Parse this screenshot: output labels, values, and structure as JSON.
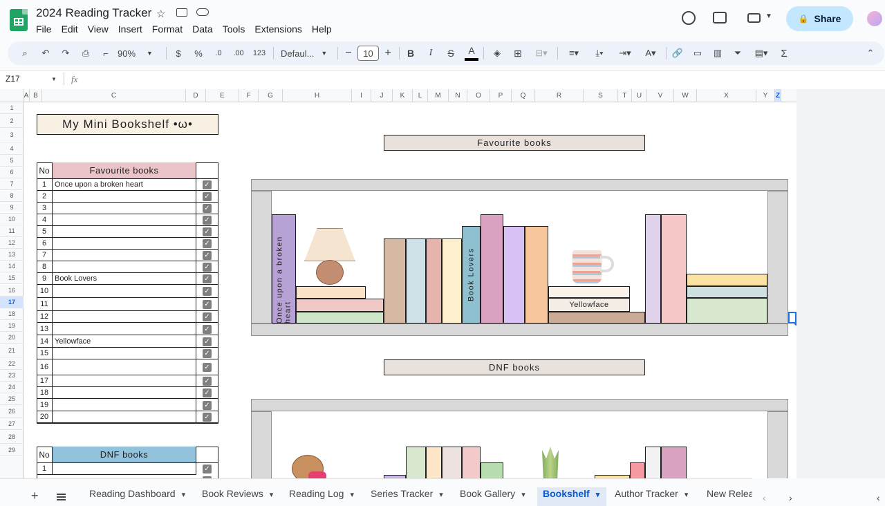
{
  "doc": {
    "title": "2024 Reading Tracker"
  },
  "menu": [
    "File",
    "Edit",
    "View",
    "Insert",
    "Format",
    "Data",
    "Tools",
    "Extensions",
    "Help"
  ],
  "share": {
    "label": "Share"
  },
  "toolbar": {
    "zoom": "90%",
    "currency": "$",
    "percent": "%",
    "dec_dec": ".0",
    "dec_inc": ".00",
    "format": "123",
    "font": "Defaul...",
    "size": "10"
  },
  "formula": {
    "namebox": "Z17",
    "fx": "fx"
  },
  "columns": [
    "A",
    "B",
    "C",
    "D",
    "E",
    "F",
    "G",
    "H",
    "I",
    "J",
    "K",
    "L",
    "M",
    "N",
    "O",
    "P",
    "Q",
    "R",
    "S",
    "T",
    "U",
    "V",
    "W",
    "X",
    "Y",
    "Z"
  ],
  "rows": [
    "1",
    "2",
    "3",
    "4",
    "5",
    "6",
    "7",
    "8",
    "9",
    "10",
    "11",
    "12",
    "13",
    "14",
    "15",
    "16",
    "17",
    "18",
    "19",
    "20",
    "21",
    "22",
    "23",
    "24",
    "25",
    "26",
    "27",
    "28",
    "29"
  ],
  "sheet": {
    "heading": "My Mini Bookshelf •ω•",
    "fav_header": {
      "no": "No",
      "title": "Favourite books"
    },
    "fav_rows": [
      {
        "no": "1",
        "title": "Once upon a broken heart"
      },
      {
        "no": "2",
        "title": ""
      },
      {
        "no": "3",
        "title": ""
      },
      {
        "no": "4",
        "title": ""
      },
      {
        "no": "5",
        "title": ""
      },
      {
        "no": "6",
        "title": ""
      },
      {
        "no": "7",
        "title": ""
      },
      {
        "no": "8",
        "title": ""
      },
      {
        "no": "9",
        "title": "Book Lovers"
      },
      {
        "no": "10",
        "title": ""
      },
      {
        "no": "11",
        "title": ""
      },
      {
        "no": "12",
        "title": ""
      },
      {
        "no": "13",
        "title": ""
      },
      {
        "no": "14",
        "title": "Yellowface"
      },
      {
        "no": "15",
        "title": ""
      },
      {
        "no": "16",
        "title": ""
      },
      {
        "no": "17",
        "title": ""
      },
      {
        "no": "18",
        "title": ""
      },
      {
        "no": "19",
        "title": ""
      },
      {
        "no": "20",
        "title": ""
      }
    ],
    "dnf_header": {
      "no": "No",
      "title": "DNF books"
    },
    "dnf_rows": [
      {
        "no": "1",
        "title": ""
      }
    ],
    "fav_shelf_label": "Favourite books",
    "dnf_shelf_label": "DNF books",
    "spine_1": "Once upon a broken heart",
    "spine_2": "Book Lovers",
    "stack_label": "Yellowface"
  },
  "tabs": [
    "Reading Dashboard",
    "Book Reviews",
    "Reading Log",
    "Series Tracker",
    "Book Gallery",
    "Bookshelf",
    "Author Tracker",
    "New Relea"
  ],
  "active_tab": "Bookshelf"
}
